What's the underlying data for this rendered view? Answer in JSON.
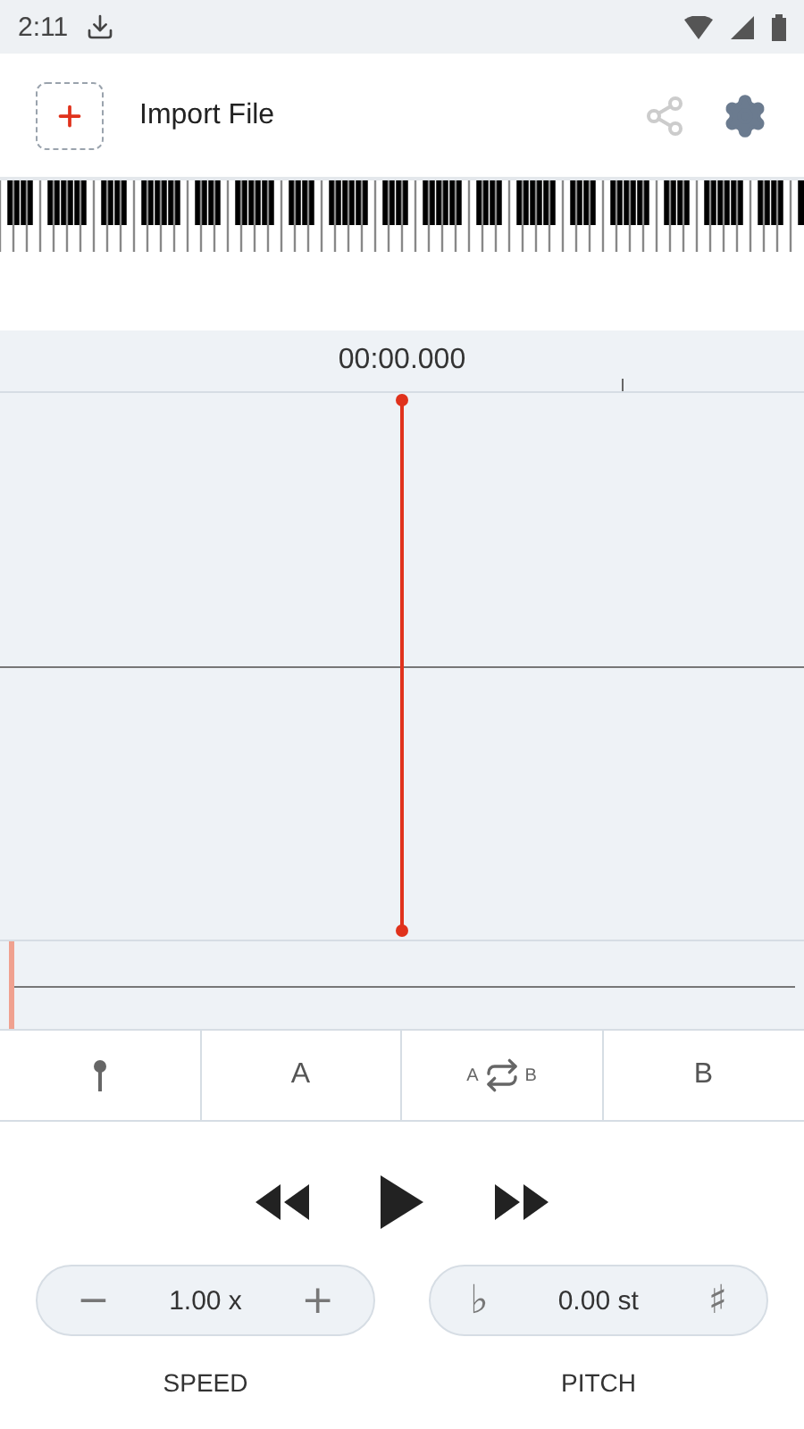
{
  "status_bar": {
    "time": "2:11"
  },
  "header": {
    "title": "Import File"
  },
  "timeline": {
    "time": "00:00.000"
  },
  "markers": [
    {
      "kind": "pin"
    },
    {
      "kind": "text",
      "label": "A"
    },
    {
      "kind": "loop",
      "start": "A",
      "end": "B"
    },
    {
      "kind": "text",
      "label": "B"
    }
  ],
  "speed": {
    "value": "1.00 x",
    "label": "SPEED",
    "down": "−",
    "up": "+"
  },
  "pitch": {
    "value": "0.00 st",
    "label": "PITCH",
    "down": "♭",
    "up": "♯"
  }
}
